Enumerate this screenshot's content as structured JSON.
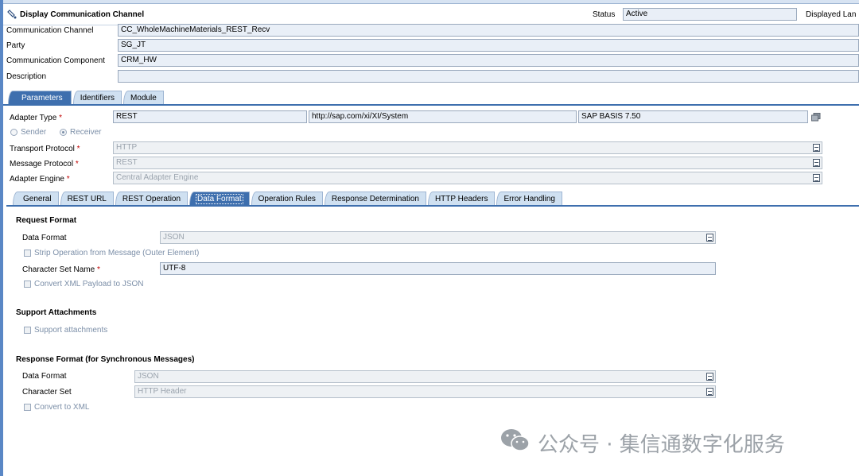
{
  "header": {
    "title": "Display Communication Channel",
    "status_label": "Status",
    "status_value": "Active",
    "displayed_lang_label": "Displayed Lan"
  },
  "general": {
    "communication_channel_label": "Communication Channel",
    "communication_channel_value": "CC_WholeMachineMaterials_REST_Recv",
    "party_label": "Party",
    "party_value": "SG_JT",
    "component_label": "Communication Component",
    "component_value": "CRM_HW",
    "description_label": "Description",
    "description_value": ""
  },
  "main_tabs": [
    "Parameters",
    "Identifiers",
    "Module"
  ],
  "adapter": {
    "type_label": "Adapter Type",
    "type_value": "REST",
    "namespace_value": "http://sap.com/xi/XI/System",
    "swc_value": "SAP BASIS 7.50",
    "sender_label": "Sender",
    "receiver_label": "Receiver",
    "transport_label": "Transport Protocol",
    "transport_value": "HTTP",
    "message_label": "Message Protocol",
    "message_value": "REST",
    "engine_label": "Adapter Engine",
    "engine_value": "Central Adapter Engine",
    "required_mark": "*"
  },
  "sub_tabs": [
    "General",
    "REST URL",
    "REST Operation",
    "Data Format",
    "Operation Rules",
    "Response Determination",
    "HTTP Headers",
    "Error Handling"
  ],
  "request": {
    "heading": "Request Format",
    "data_format_label": "Data Format",
    "data_format_value": "JSON",
    "strip_label": "Strip Operation from Message (Outer Element)",
    "charset_label": "Character Set Name",
    "charset_value": "UTF-8",
    "convert_label": "Convert XML Payload to JSON"
  },
  "attachments": {
    "heading": "Support Attachments",
    "support_label": "Support attachments"
  },
  "response": {
    "heading": "Response Format (for Synchronous Messages)",
    "data_format_label": "Data Format",
    "data_format_value": "JSON",
    "charset_label": "Character Set",
    "charset_value": "HTTP Header",
    "convert_label": "Convert to XML"
  },
  "watermark": {
    "text": "公众号 · 集信通数字化服务",
    "icon": "wechat-icon"
  },
  "colors": {
    "accent": "#3e6fae",
    "field_bg": "#e9eff7",
    "tab_bg": "#cfe0f1"
  }
}
